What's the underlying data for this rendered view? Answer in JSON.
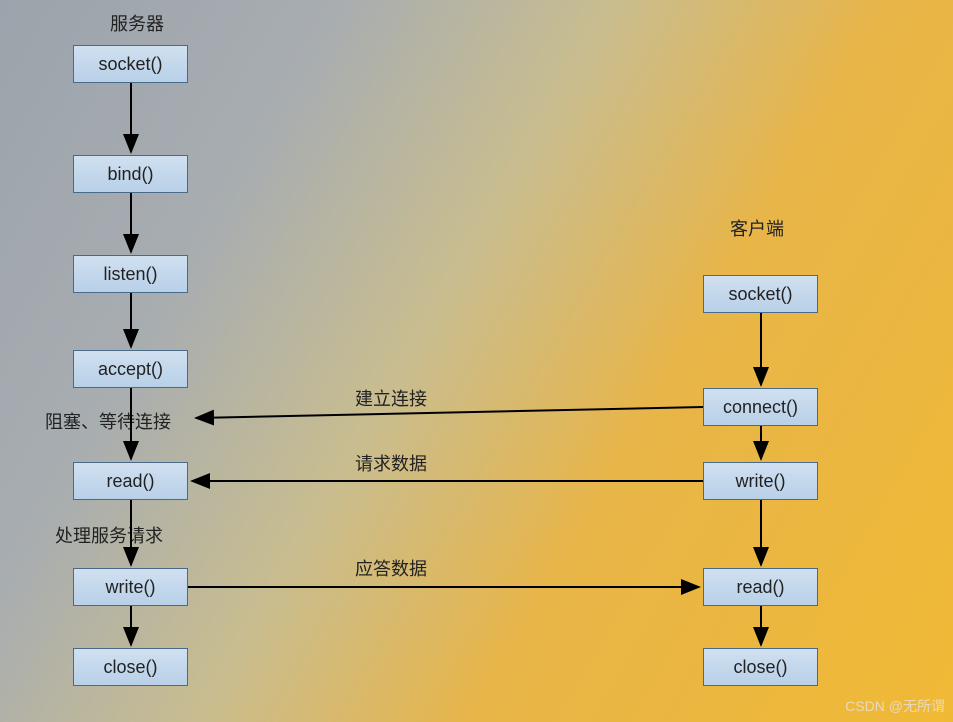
{
  "titles": {
    "server": "服务器",
    "client": "客户端"
  },
  "server_nodes": {
    "socket": "socket()",
    "bind": "bind()",
    "listen": "listen()",
    "accept": "accept()",
    "read": "read()",
    "write": "write()",
    "close": "close()"
  },
  "client_nodes": {
    "socket": "socket()",
    "connect": "connect()",
    "write": "write()",
    "read": "read()",
    "close": "close()"
  },
  "labels": {
    "block_wait": "阻塞、等待连接",
    "process_req": "处理服务请求",
    "establish": "建立连接",
    "request": "请求数据",
    "response": "应答数据"
  },
  "watermark": "CSDN @无所谓"
}
